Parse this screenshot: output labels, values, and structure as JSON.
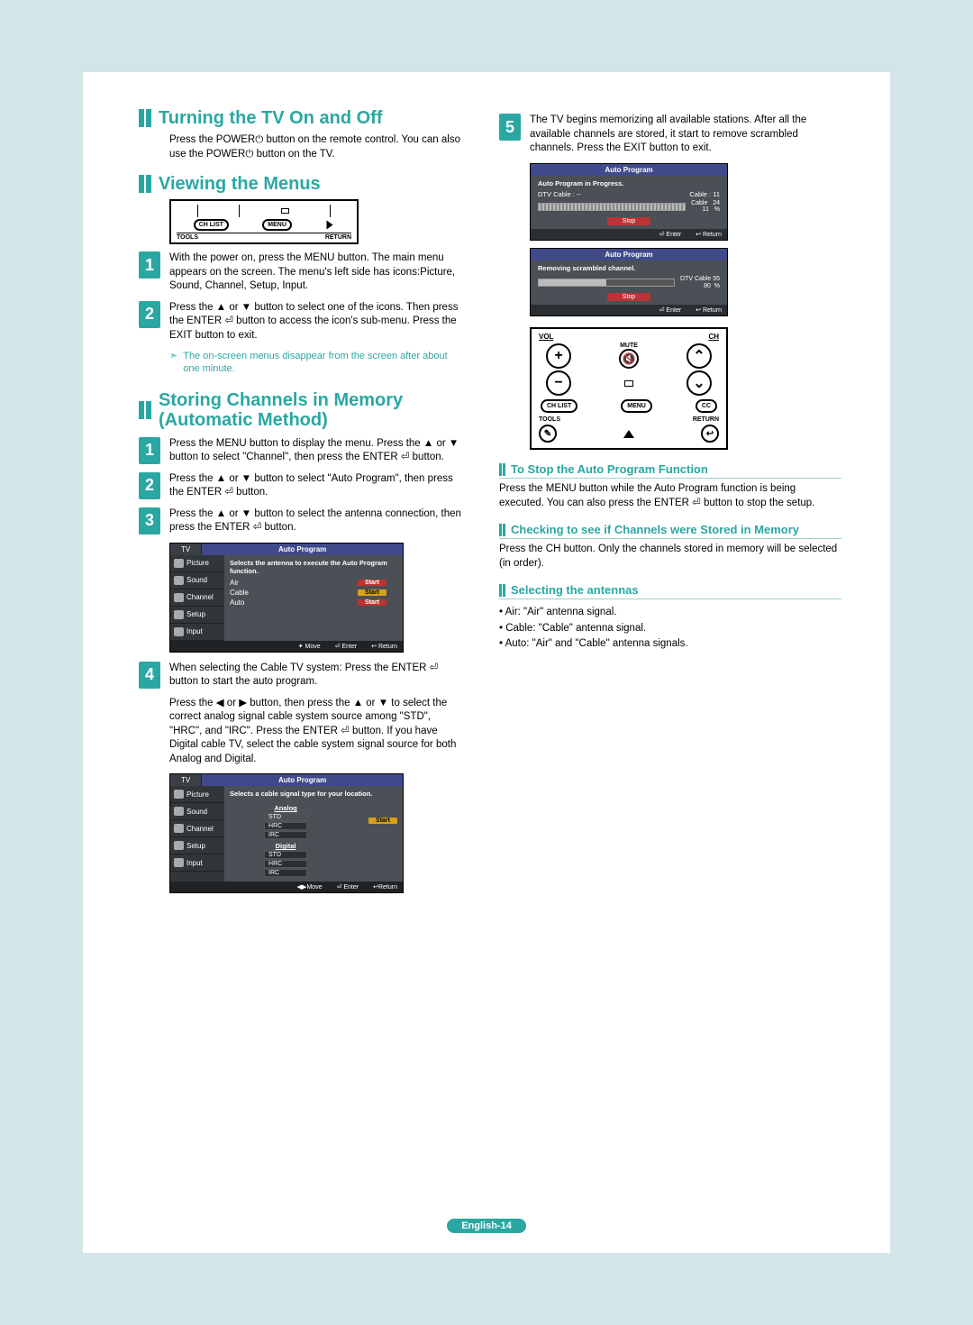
{
  "footer": "English-14",
  "left": {
    "section1": {
      "title": "Turning the TV On and Off",
      "body": "Press the POWER⏻ button on the remote control. You can also use the POWER⏻ button on the TV."
    },
    "section2": {
      "title": "Viewing the Menus",
      "remote_labels": {
        "chlist": "CH LIST",
        "menu": "MENU",
        "tools": "TOOLS",
        "return": "RETURN"
      },
      "step1": "With the power on, press the MENU button. The main menu appears on the screen. The menu's left side has icons:Picture, Sound, Channel, Setup, Input.",
      "step2": "Press the ▲ or ▼ button to select one of the icons. Then press the ENTER ⏎ button to access the icon's sub-menu. Press the EXIT button to exit.",
      "note": "The on-screen menus disappear from the screen after about one minute."
    },
    "section3": {
      "title": "Storing Channels in Memory (Automatic Method)",
      "step1": "Press the MENU button to display the menu. Press the ▲ or ▼ button to select \"Channel\", then press the ENTER ⏎ button.",
      "step2": "Press the ▲ or ▼ button to select \"Auto Program\", then press the ENTER ⏎ button.",
      "step3": "Press the ▲ or ▼ button to select the antenna connection, then press the ENTER ⏎ button.",
      "menu1": {
        "tab_left": "TV",
        "tab_center": "Auto Program",
        "desc": "Selects the antenna to execute the Auto Program function.",
        "side_items": [
          "Picture",
          "Sound",
          "Channel",
          "Setup",
          "Input"
        ],
        "rows": [
          {
            "label": "Air",
            "btn": "Start",
            "sel": false
          },
          {
            "label": "Cable",
            "btn": "Start",
            "sel": true
          },
          {
            "label": "Auto",
            "btn": "Start",
            "sel": false
          }
        ],
        "foot": [
          "✦ Move",
          "⏎ Enter",
          "↩ Return"
        ]
      },
      "step4a": "When selecting the Cable TV system: Press the ENTER ⏎ button to start the auto program.",
      "step4b": "Press the ◀ or ▶ button, then press the ▲ or ▼ to select the correct analog signal cable system source among \"STD\", \"HRC\", and \"IRC\". Press the ENTER ⏎ button. If you have Digital cable TV, select the cable system signal source for both Analog and Digital.",
      "menu2": {
        "tab_left": "TV",
        "tab_center": "Auto Program",
        "desc": "Selects a cable signal type for your location.",
        "side_items": [
          "Picture",
          "Sound",
          "Channel",
          "Setup",
          "Input"
        ],
        "group1": "Analog",
        "opts1": [
          "STD",
          "HRC",
          "IRC"
        ],
        "group2": "Digital",
        "opts2": [
          "STD",
          "HRC",
          "IRC"
        ],
        "start_btn": "Start",
        "foot": [
          "◀▶Move",
          "⏎ Enter",
          "↩Return"
        ]
      }
    }
  },
  "right": {
    "step5": "The TV begins memorizing all available stations. After all the available channels are stored, it start to remove scrambled channels. Press the EXIT button to exit.",
    "prog1": {
      "title": "Auto Program",
      "line1": "Auto Program in Progress.",
      "left_label": "DTV Cable : --",
      "right_label": "Cable : 11",
      "side": "Cable   24\n11   %",
      "stop": "Stop",
      "foot": [
        "⏎ Enter",
        "↩ Return"
      ]
    },
    "prog2": {
      "title": "Auto Program",
      "line1": "Removing scrambled channel.",
      "side": "DTV Cable 55\n80  %",
      "stop": "Stop",
      "foot": [
        "⏎ Enter",
        "↩ Return"
      ]
    },
    "remote": {
      "vol": "VOL",
      "ch": "CH",
      "mute": "MUTE",
      "chlist": "CH LIST",
      "menu": "MENU",
      "cc": "CC",
      "tools": "TOOLS",
      "return": "RETURN"
    },
    "sub1": {
      "title": "To Stop the Auto Program Function",
      "body": "Press the MENU button while the Auto Program function is being executed. You can also press the ENTER ⏎ button to stop the setup."
    },
    "sub2": {
      "title": "Checking to see if Channels were Stored in Memory",
      "body": "Press the CH button. Only the channels stored in memory will be selected (in order)."
    },
    "sub3": {
      "title": "Selecting the antennas",
      "bullet1": "Air: \"Air\" antenna signal.",
      "bullet2": "Cable: \"Cable\" antenna signal.",
      "bullet3": "Auto: \"Air\" and \"Cable\" antenna signals."
    }
  }
}
